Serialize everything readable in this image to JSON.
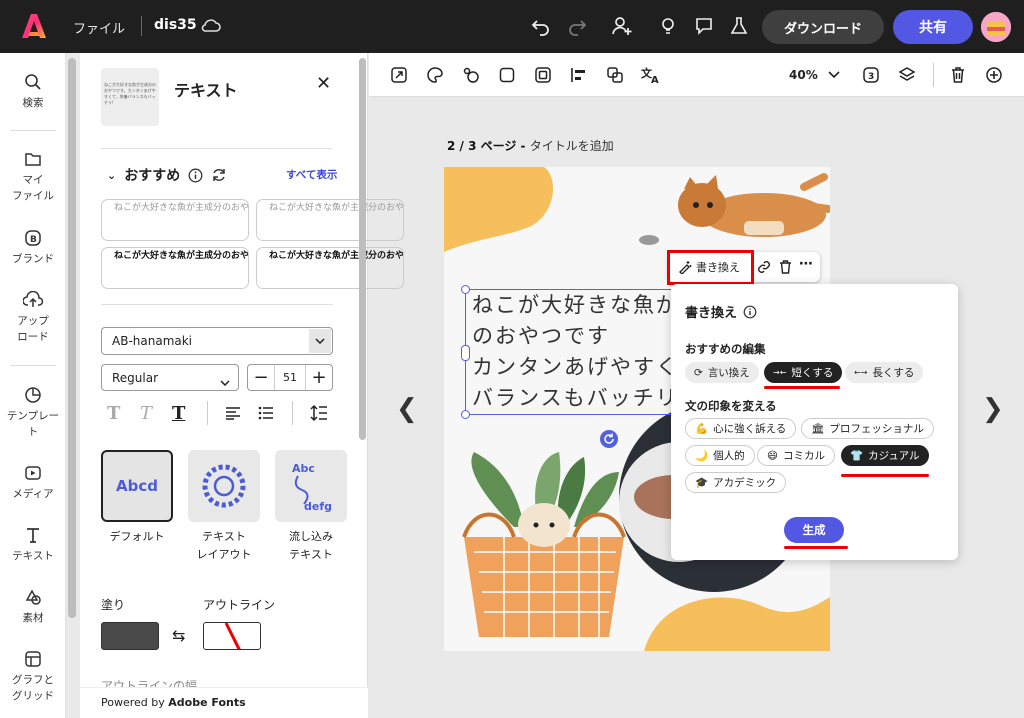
{
  "topbar": {
    "file_menu": "ファイル",
    "doc_name": "dis35",
    "download": "ダウンロード",
    "share": "共有"
  },
  "rail": {
    "items": [
      {
        "label": "検索",
        "icon": "search-icon"
      },
      {
        "label": "マイ\nファイル",
        "icon": "folder-icon"
      },
      {
        "label": "ブランド",
        "icon": "brand-icon"
      },
      {
        "label": "アップ\nロード",
        "icon": "upload-icon"
      },
      {
        "label": "テンプレー\nト",
        "icon": "template-icon"
      },
      {
        "label": "メディア",
        "icon": "media-icon"
      },
      {
        "label": "テキスト",
        "icon": "text-icon"
      },
      {
        "label": "素材",
        "icon": "elements-icon"
      },
      {
        "label": "グラフと\nグリッド",
        "icon": "grid-icon"
      }
    ]
  },
  "panel": {
    "title": "テキスト",
    "thumb_text": "ねこが大好きな魚が主成分のおやつです。カンタンあげやすくて、栄養バランスもバッチリ!",
    "section": "おすすめ",
    "see_all": "すべて表示",
    "cards": [
      "ねこが大好きな魚が主成分のおやつです。カンタンあげやすく、栄養",
      "ねこが大好きな魚が主成分のおやつです。カンタンあげやすく",
      "ねこが大好きな魚が主成分のおやつです。カンタンあげやすく、栄養",
      "ねこが大好きな魚が主成分のおやつです。カンタンあげやすく"
    ],
    "font": "AB-hanamaki",
    "weight": "Regular",
    "size": "51",
    "layouts": [
      {
        "label": "デフォルト",
        "sample": "Abcd"
      },
      {
        "label": "テキスト\nレイアウト",
        "sample": "ABCDEFGHIJKL"
      },
      {
        "label": "流し込み\nテキスト",
        "sample": "Abc defg"
      }
    ],
    "fill_label": "塗り",
    "outline_label": "アウトライン",
    "cut_label": "アウトラインの幅",
    "footer_prefix": "Powered by ",
    "footer_brand": "Adobe Fonts"
  },
  "canvas": {
    "zoom": "40%",
    "page_label": "2 / 3 ページ - ",
    "add_title": "タイトルを追加",
    "text_lines": [
      "ねこが大好きな魚が",
      "のおやつです",
      "カンタンあげやすく",
      "バランスもバッチリ"
    ]
  },
  "context_bar": {
    "rewrite": "書き換え"
  },
  "popover": {
    "title": "書き換え",
    "edit_section": "おすすめの編集",
    "edit_chips": [
      "言い換え",
      "短くする",
      "長くする"
    ],
    "tone_section": "文の印象を変える",
    "tone_chips": [
      "心に強く訴える",
      "プロフェッショナル",
      "個人的",
      "コミカル",
      "カジュアル",
      "アカデミック"
    ],
    "generate": "生成"
  },
  "colors": {
    "accent": "#5258e4",
    "highlight": "#e00000",
    "topbar": "#1f1f1f",
    "fill_swatch": "#4a4a4a",
    "orange": "#f6bf5b"
  }
}
